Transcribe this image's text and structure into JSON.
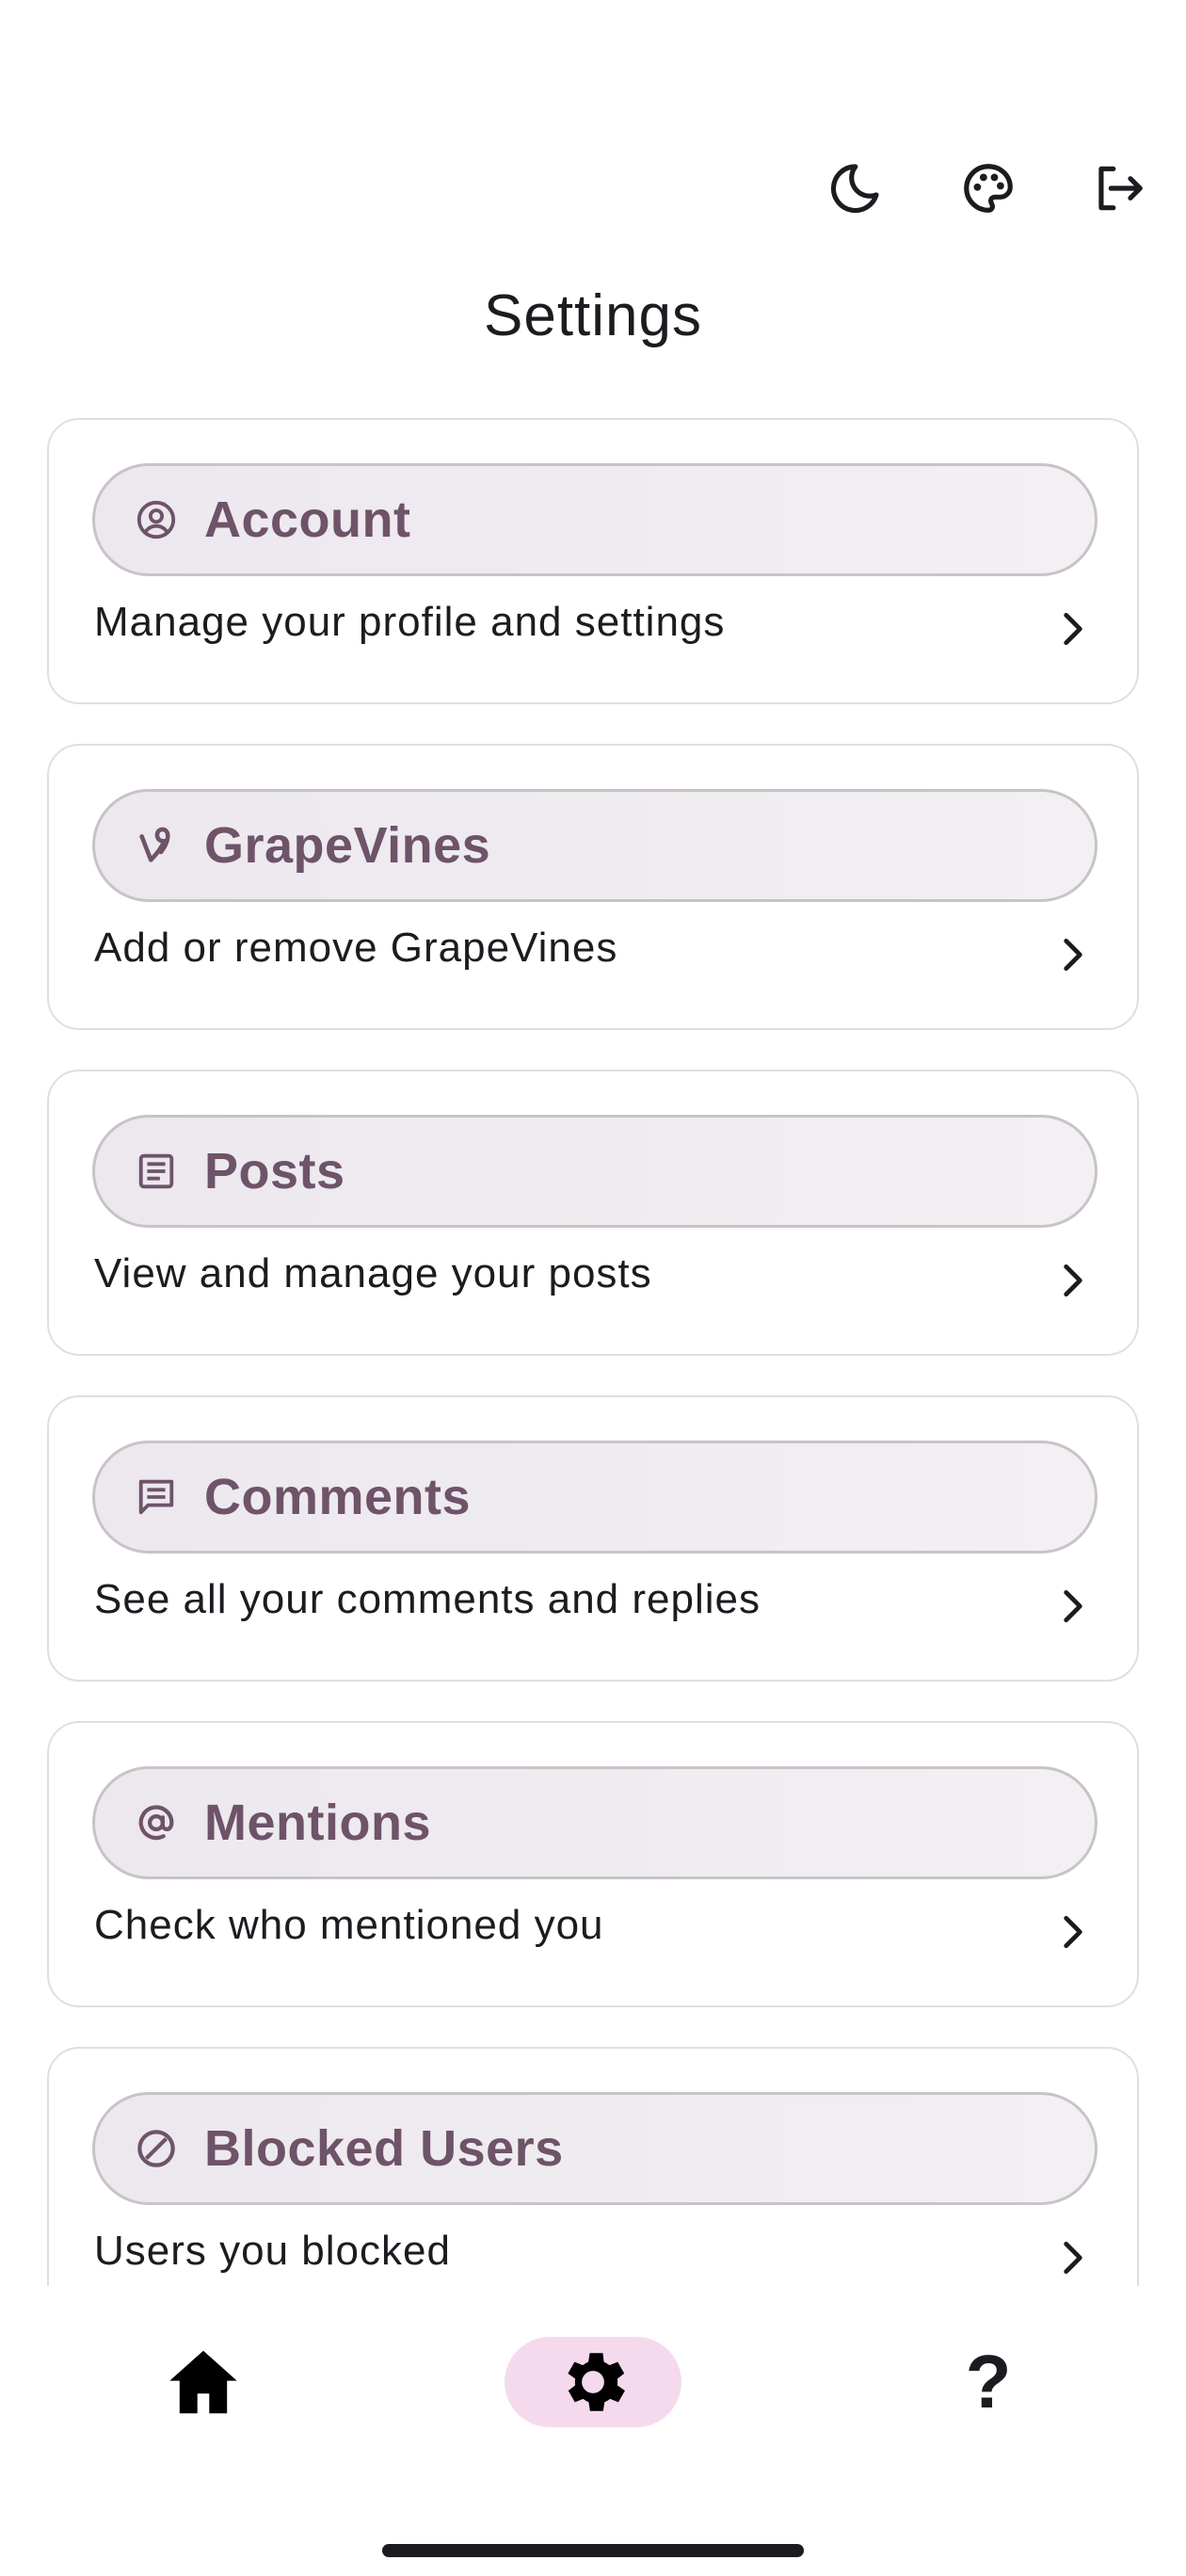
{
  "header": {
    "title": "Settings",
    "actions": [
      {
        "name": "dark-mode-icon"
      },
      {
        "name": "palette-icon"
      },
      {
        "name": "logout-icon"
      }
    ]
  },
  "cards": [
    {
      "title": "Account",
      "desc": "Manage your profile and settings",
      "icon": "account-circle-icon"
    },
    {
      "title": "GrapeVines",
      "desc": "Add or remove GrapeVines",
      "icon": "vine-icon"
    },
    {
      "title": "Posts",
      "desc": "View and manage your posts",
      "icon": "article-icon"
    },
    {
      "title": "Comments",
      "desc": "See all your comments and replies",
      "icon": "comment-icon"
    },
    {
      "title": "Mentions",
      "desc": "Check who mentioned you",
      "icon": "at-sign-icon"
    },
    {
      "title": "Blocked Users",
      "desc": "Users you blocked",
      "icon": "block-icon"
    }
  ],
  "bottom_nav": {
    "items": [
      "home-icon",
      "settings-icon",
      "help-icon"
    ],
    "active": "settings",
    "help_glyph": "?"
  },
  "colors": {
    "accent": "#6e5369",
    "chip_bg": "#ece8ee",
    "nav_active_bg": "#f5daee"
  }
}
